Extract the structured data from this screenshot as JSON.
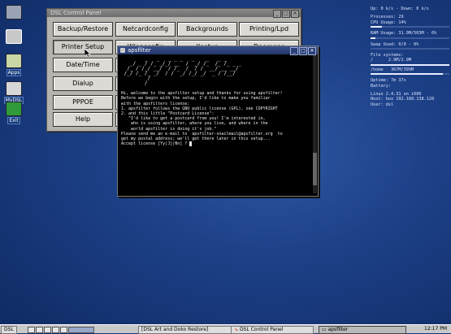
{
  "desktop_icons": [
    {
      "label": "",
      "icon": "terminal-icon"
    },
    {
      "label": "",
      "icon": "pencil-icon"
    },
    {
      "label": "Apps",
      "icon": "folder-apps-icon"
    },
    {
      "label": "MyDSL",
      "icon": "mydsl-icon"
    },
    {
      "label": "Exit",
      "icon": "exit-icon"
    }
  ],
  "control_panel": {
    "title": "DSL Control Panel",
    "buttons": [
      "Backup/Restore",
      "Netcardconfig",
      "Backgrounds",
      "Printing/Lpd",
      "Printer Setup",
      "Wlanconfig",
      "Xsetup",
      "Daemons",
      "Date/Time",
      "",
      "",
      "",
      "Dialup",
      "",
      "",
      "",
      "PPPOE",
      "",
      "",
      "",
      "Help",
      "",
      "",
      ""
    ]
  },
  "terminal": {
    "title": "apsfilter",
    "ascii_art": "        _   _   _ _ _   _    _   _ _\n   _/ _ / /_ _/_/ __  /  _/ /_  /_ /_ _ _\n  /_ / /_/ __/  / /_  /  / /  __/ __ __/\n /_/ /_ /_ _/  / /  _/ /_/ _/  _ / /__/\n         /\n        /",
    "lines": [
      "Hi, welcome to the apsfilter setup and thanks for using apsfilter!",
      "",
      "Before we begin with the setup, I'd like to make you familiar",
      "with the apsfilters license:",
      "1. apsfilter follows the GNU public license (GPL), see COPYRIGHT",
      "2. and this little \"Postcard License\":",
      "",
      "   \"I'd like to get a postcard from you! I'm interested in,",
      "    who is using apsfilter, where you live, and where in the",
      "    world apsfilter is doing it's job.\"",
      "",
      "Please send me an e-mail to  apsfilter-snailmail@apsfilter.org  to",
      "get my postal address; we'll get there later in this setup...",
      "",
      "Accept license [Yy|Jj|Nn] ? "
    ]
  },
  "monitor": {
    "net": "Up: 0 k/s - Down: 0 k/s",
    "processes": "Processes: 29",
    "cpu": "CPU Usage: 14%",
    "cpu_fraction": 0.14,
    "ram": "RAM Usage: 31.9M/503M - 6%",
    "ram_fraction": 0.06,
    "swap": "Swap Used: 0/0 - 0%",
    "swap_fraction": 0.0,
    "fs_label": "File systems:",
    "fs_root_name": "/",
    "fs_root_val": "2.9M/2.9M",
    "fs_root_fraction": 1.0,
    "fs_home_name": "/home",
    "fs_home_val": "367M/399M",
    "fs_home_fraction": 0.92,
    "uptime": "Uptime:   7m 37s",
    "battery": "Battery:",
    "linux": "Linux 2.4.31 on i686",
    "host": "Host: box 192.168.138.128",
    "user": "User: dsl"
  },
  "taskbar": {
    "start": "DSL",
    "tasks": [
      {
        "label": "[DSL Art and Doko Restore]",
        "active": false
      },
      {
        "label": "DSL Control Panel",
        "active": false
      },
      {
        "label": "apsfilter",
        "active": true
      }
    ],
    "clock": "12:17 PM"
  }
}
